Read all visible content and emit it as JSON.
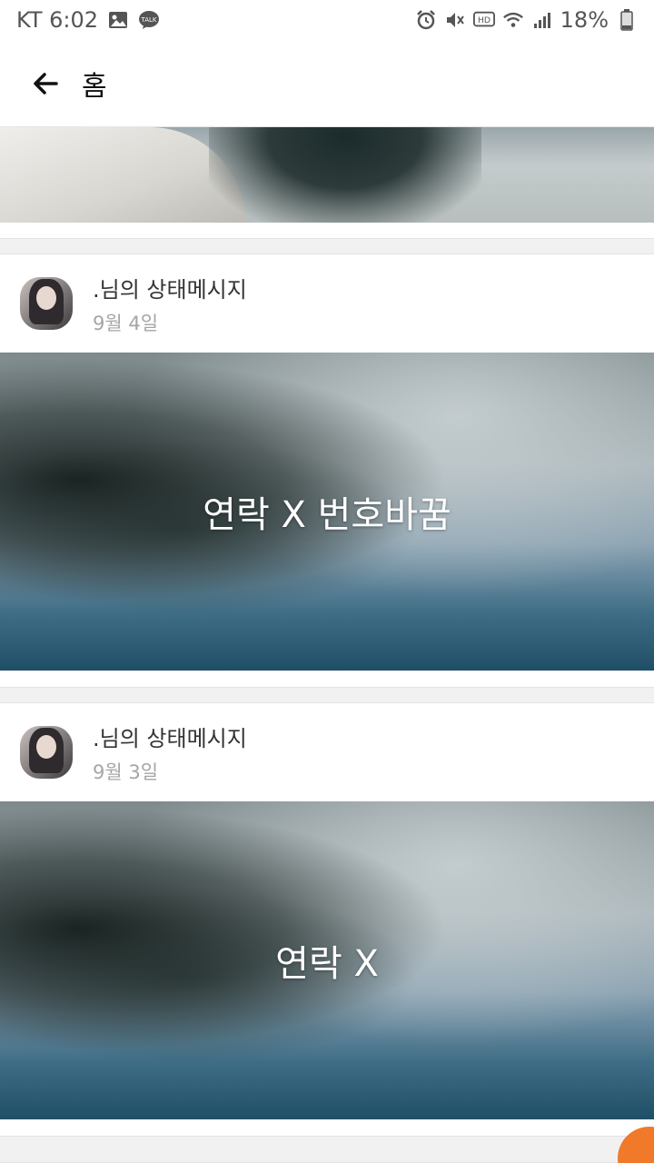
{
  "status_bar": {
    "carrier_time": "KT 6:02",
    "battery": "18%"
  },
  "app_bar": {
    "title": "홈"
  },
  "posts": [
    {
      "name": ".님의 상태메시지",
      "date": "9월 4일",
      "caption": "연락 X 번호바꿈"
    },
    {
      "name": ".님의 상태메시지",
      "date": "9월 3일",
      "caption": "연락 X"
    }
  ]
}
